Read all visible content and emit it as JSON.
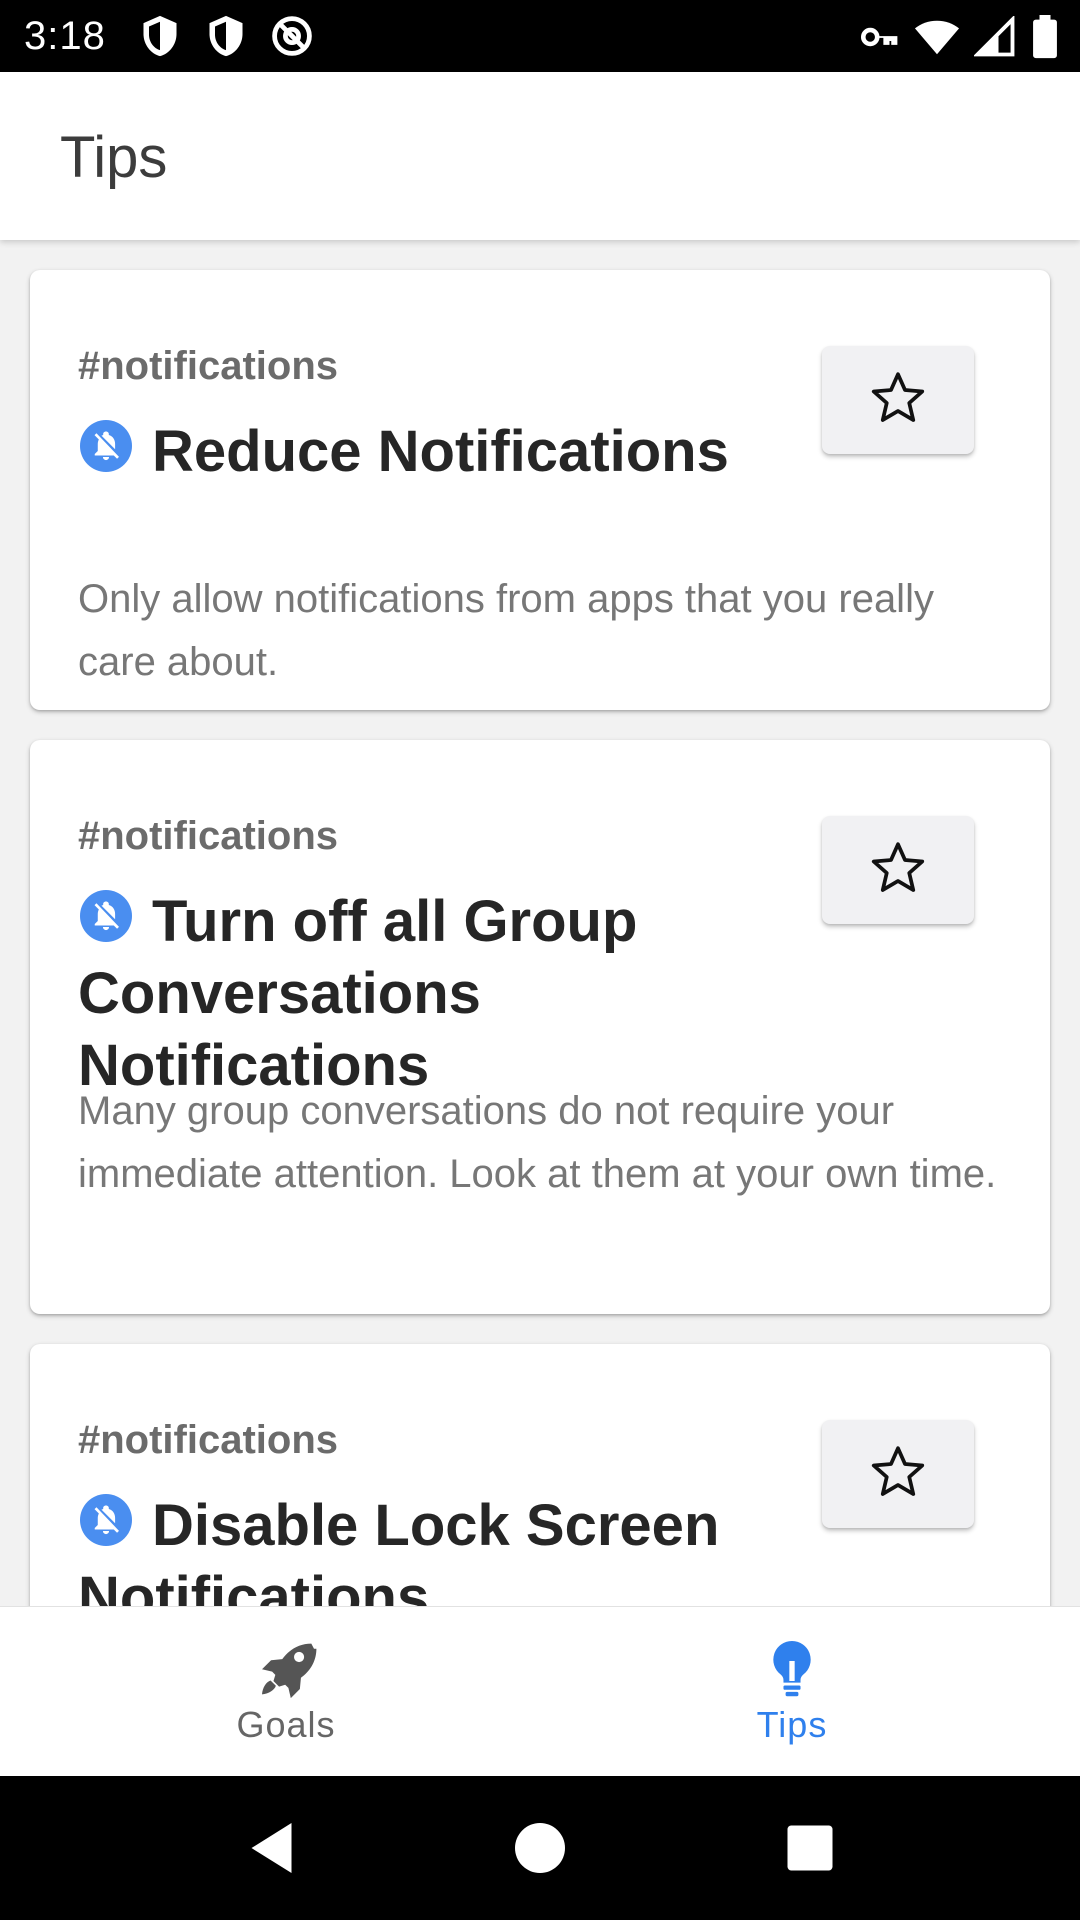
{
  "status_bar": {
    "time": "3:18",
    "left_icons": [
      "shield-icon",
      "shield-icon",
      "at-sign-icon"
    ],
    "right_icons": [
      "vpn-key-icon",
      "wifi-icon",
      "signal-icon",
      "battery-icon"
    ]
  },
  "app_bar": {
    "title": "Tips"
  },
  "cards": [
    {
      "tag": "#notifications",
      "icon": "notifications-off-icon",
      "title": "Reduce Notifications",
      "description": "Only allow notifications from apps that you really care about.",
      "favorite_icon": "star-outline-icon"
    },
    {
      "tag": "#notifications",
      "icon": "notifications-off-icon",
      "title": "Turn off all Group Conversations Notifications",
      "description": "Many group conversations do not require your immediate attention. Look at them at your own time.",
      "favorite_icon": "star-outline-icon"
    },
    {
      "tag": "#notifications",
      "icon": "notifications-off-icon",
      "title": "Disable Lock Screen Notifications",
      "description": "",
      "favorite_icon": "star-outline-icon"
    }
  ],
  "bottom_nav": {
    "items": [
      {
        "label": "Goals",
        "icon": "rocket-icon",
        "active": false
      },
      {
        "label": "Tips",
        "icon": "lightbulb-icon",
        "active": true
      }
    ]
  },
  "colors": {
    "accent": "#2f80ed",
    "inactive": "#666666",
    "notification_icon": "#4a8ef0"
  },
  "system_nav": {
    "icons": [
      "back-icon",
      "home-icon",
      "recents-icon"
    ]
  }
}
